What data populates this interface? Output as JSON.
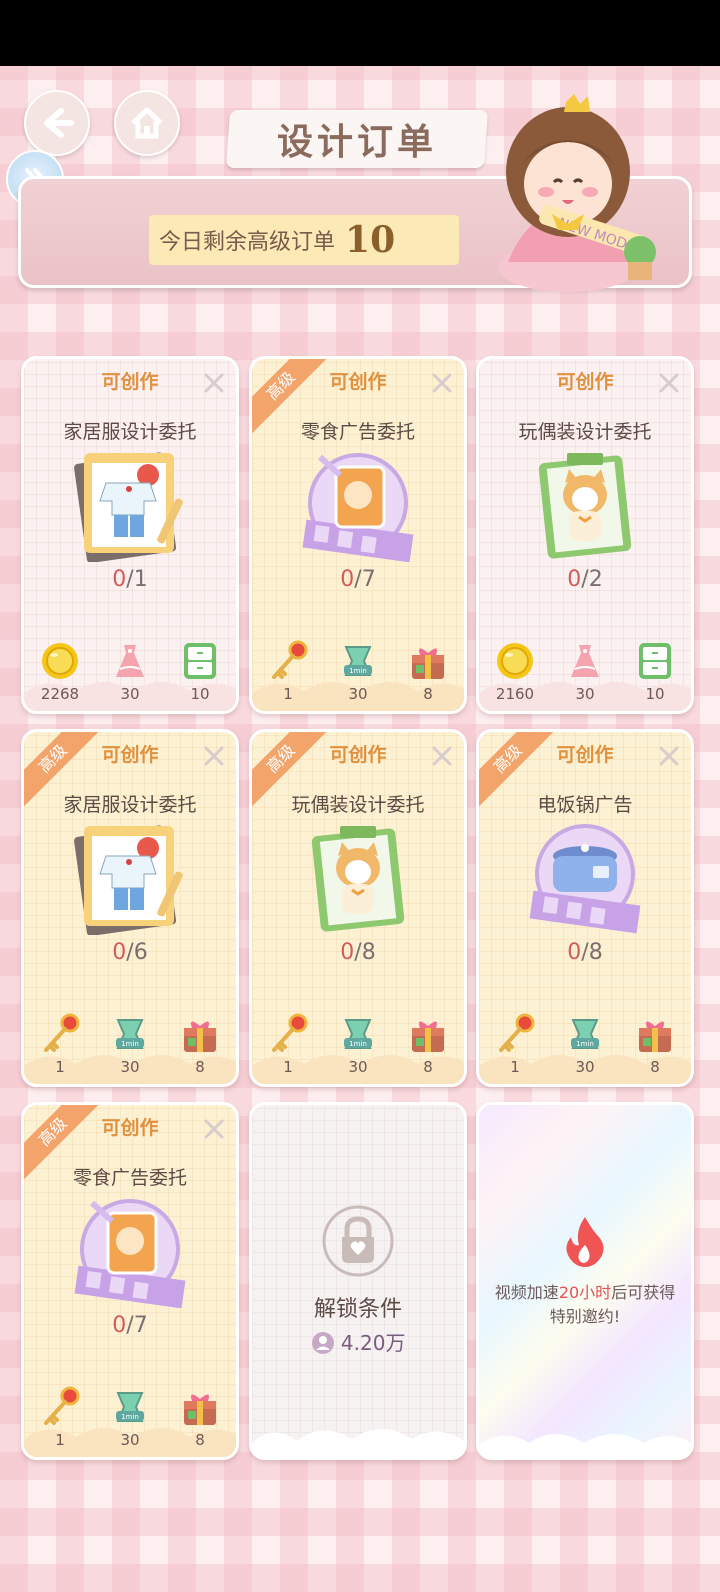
{
  "header": {
    "title": "设计订单",
    "remain_label": "今日剩余高级订单",
    "remain_count": "10",
    "mascot_text": "NEW MODE"
  },
  "cards": [
    {
      "status": "可创作",
      "advanced": false,
      "name": "家居服设计委托",
      "art": "homewear",
      "progress_cur": "0",
      "progress_total": "/1",
      "rewards": [
        {
          "icon": "gold-coin",
          "value": "2268"
        },
        {
          "icon": "dress",
          "value": "30"
        },
        {
          "icon": "cabinet",
          "value": "10"
        }
      ]
    },
    {
      "status": "可创作",
      "advanced": true,
      "badge": "高级",
      "name": "零食广告委托",
      "art": "snack",
      "progress_cur": "0",
      "progress_total": "/7",
      "rewards": [
        {
          "icon": "key",
          "value": "1"
        },
        {
          "icon": "timer-1min",
          "value": "30"
        },
        {
          "icon": "gift-box",
          "value": "8"
        }
      ]
    },
    {
      "status": "可创作",
      "advanced": false,
      "name": "玩偶装设计委托",
      "art": "doll",
      "progress_cur": "0",
      "progress_total": "/2",
      "rewards": [
        {
          "icon": "gold-coin",
          "value": "2160"
        },
        {
          "icon": "dress",
          "value": "30"
        },
        {
          "icon": "cabinet",
          "value": "10"
        }
      ]
    },
    {
      "status": "可创作",
      "advanced": true,
      "badge": "高级",
      "name": "家居服设计委托",
      "art": "homewear",
      "progress_cur": "0",
      "progress_total": "/6",
      "rewards": [
        {
          "icon": "key",
          "value": "1"
        },
        {
          "icon": "timer-1min",
          "value": "30"
        },
        {
          "icon": "gift-box",
          "value": "8"
        }
      ]
    },
    {
      "status": "可创作",
      "advanced": true,
      "badge": "高级",
      "name": "玩偶装设计委托",
      "art": "doll",
      "progress_cur": "0",
      "progress_total": "/8",
      "rewards": [
        {
          "icon": "key",
          "value": "1"
        },
        {
          "icon": "timer-1min",
          "value": "30"
        },
        {
          "icon": "gift-box",
          "value": "8"
        }
      ]
    },
    {
      "status": "可创作",
      "advanced": true,
      "badge": "高级",
      "name": "电饭锅广告",
      "art": "ricecooker",
      "progress_cur": "0",
      "progress_total": "/8",
      "rewards": [
        {
          "icon": "key",
          "value": "1"
        },
        {
          "icon": "timer-1min",
          "value": "30"
        },
        {
          "icon": "gift-box",
          "value": "8"
        }
      ]
    },
    {
      "status": "可创作",
      "advanced": true,
      "badge": "高级",
      "name": "零食广告委托",
      "art": "snack",
      "progress_cur": "0",
      "progress_total": "/7",
      "rewards": [
        {
          "icon": "key",
          "value": "1"
        },
        {
          "icon": "timer-1min",
          "value": "30"
        },
        {
          "icon": "gift-box",
          "value": "8"
        }
      ]
    }
  ],
  "locked_card": {
    "title": "解锁条件",
    "requirement": "4.20万"
  },
  "video_card": {
    "text_before": "视频加速",
    "highlight": "20小时",
    "text_after": "后可获得",
    "line2": "特别邀约!"
  },
  "colors": {
    "accent": "#e0913f",
    "advanced_badge": "#f2a46b",
    "progress_current": "#d25c5c"
  }
}
